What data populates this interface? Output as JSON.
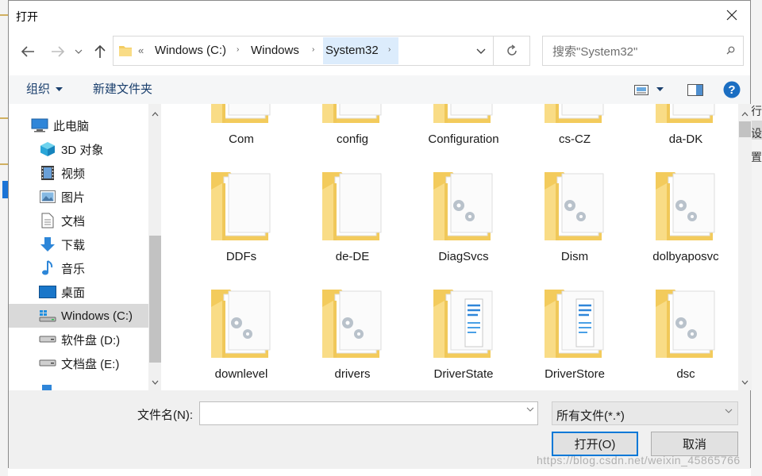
{
  "dialog": {
    "title": "打开"
  },
  "address": {
    "overflow": "«",
    "segments": [
      "Windows (C:)",
      "Windows",
      "System32"
    ]
  },
  "search": {
    "placeholder": "搜索\"System32\""
  },
  "toolbar": {
    "organize": "组织",
    "new_folder": "新建文件夹"
  },
  "nav_items": [
    {
      "label": "此电脑",
      "icon": "computer-icon"
    },
    {
      "label": "3D 对象",
      "icon": "cube-3d-icon"
    },
    {
      "label": "视频",
      "icon": "video-icon"
    },
    {
      "label": "图片",
      "icon": "picture-icon"
    },
    {
      "label": "文档",
      "icon": "document-icon"
    },
    {
      "label": "下载",
      "icon": "download-arrow-icon"
    },
    {
      "label": "音乐",
      "icon": "music-note-icon"
    },
    {
      "label": "桌面",
      "icon": "desktop-icon"
    },
    {
      "label": "Windows (C:)",
      "icon": "system-drive-icon",
      "selected": true
    },
    {
      "label": "软件盘 (D:)",
      "icon": "drive-icon"
    },
    {
      "label": "文档盘 (E:)",
      "icon": "drive-icon"
    }
  ],
  "files": [
    {
      "name": "Com",
      "type": "plain"
    },
    {
      "name": "config",
      "type": "plain"
    },
    {
      "name": "Configuration",
      "type": "gear"
    },
    {
      "name": "cs-CZ",
      "type": "plain"
    },
    {
      "name": "da-DK",
      "type": "plain"
    },
    {
      "name": "DDFs",
      "type": "plain"
    },
    {
      "name": "de-DE",
      "type": "plain"
    },
    {
      "name": "DiagSvcs",
      "type": "gear"
    },
    {
      "name": "Dism",
      "type": "gear"
    },
    {
      "name": "dolbyaposvc",
      "type": "gear"
    },
    {
      "name": "downlevel",
      "type": "gear"
    },
    {
      "name": "drivers",
      "type": "gear"
    },
    {
      "name": "DriverState",
      "type": "docs"
    },
    {
      "name": "DriverStore",
      "type": "docs"
    },
    {
      "name": "dsc",
      "type": "gear"
    }
  ],
  "bottom": {
    "filename_label": "文件名(N):",
    "filename_value": "",
    "filetype": "所有文件(*.*)",
    "open_label": "打开(O)",
    "cancel_label": "取消"
  },
  "watermark": "https://blog.csdn.net/weixin_45865766",
  "background_app": {
    "right_chars": [
      "行",
      "设",
      "置"
    ]
  },
  "colors": {
    "accent": "#0078d7",
    "address_highlight": "#dcecfc",
    "folder": "#f9d97c",
    "help": "#1b6ec2"
  }
}
